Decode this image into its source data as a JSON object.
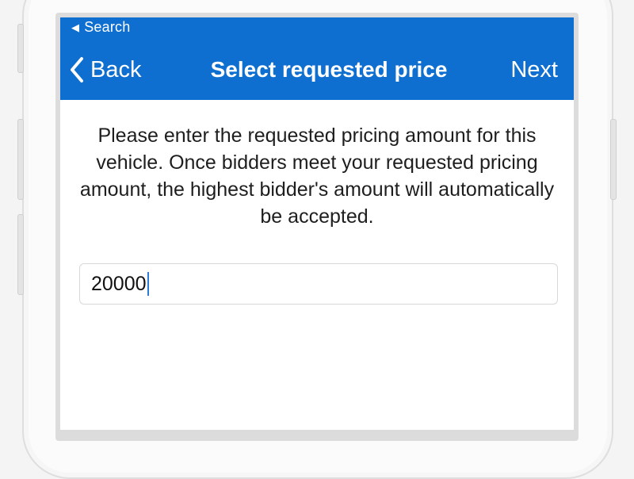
{
  "status_bar": {
    "back_to_app_label": "Search"
  },
  "navbar": {
    "back_label": "Back",
    "title": "Select requested price",
    "next_label": "Next",
    "background": "#0f6fd0"
  },
  "content": {
    "description": "Please enter the requested pricing amount for this vehicle. Once bidders meet your requested pricing amount, the highest bidder's amount will automatically be accepted.",
    "price_input": {
      "value": "20000"
    }
  }
}
